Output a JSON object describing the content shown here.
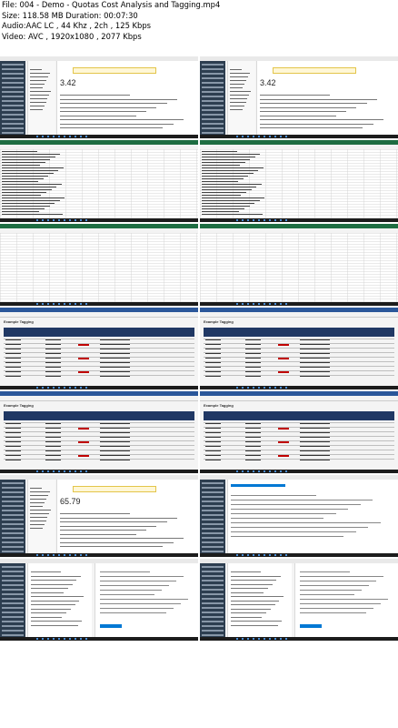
{
  "file_info": {
    "file": "File: 004 - Demo - Quotas Cost Analysis and Tagging.mp4",
    "size": "Size: 118.58 MB Duration: 00:07:30",
    "audio": "Audio:AAC LC , 44 Khz , 2ch , 125 Kbps",
    "video": "Video: AVC , 1920x1080 , 2077 Kbps"
  },
  "thumbnails": [
    {
      "name": "azure-cost-analysis",
      "kind": "portal",
      "big_value": "3.42"
    },
    {
      "name": "azure-cost-analysis-filter",
      "kind": "portal",
      "big_value": "3.42"
    },
    {
      "name": "excel-tag-list",
      "kind": "excel"
    },
    {
      "name": "excel-tag-list-2",
      "kind": "excel"
    },
    {
      "name": "excel-ribbon",
      "kind": "excel-blank"
    },
    {
      "name": "excel-ribbon-2",
      "kind": "excel-blank"
    },
    {
      "name": "example-tagging",
      "kind": "doc",
      "title": "Example Tagging"
    },
    {
      "name": "example-tagging-2",
      "kind": "doc",
      "title": "Example Tagging"
    },
    {
      "name": "example-tagging-3",
      "kind": "doc",
      "title": "Example Tagging"
    },
    {
      "name": "example-tagging-4",
      "kind": "doc",
      "title": "Example Tagging"
    },
    {
      "name": "azure-cost-analysis-2",
      "kind": "portal",
      "big_value": "65.79"
    },
    {
      "name": "azure-quota-list",
      "kind": "portal-list"
    },
    {
      "name": "azure-new-support-request",
      "kind": "portal-form"
    },
    {
      "name": "azure-new-support-request-2",
      "kind": "portal-form2"
    }
  ],
  "colors": {
    "portal_dark": "#2d3e50",
    "azure_blue": "#0078d4",
    "excel_green": "#1e6d42",
    "doc_header": "#203864",
    "taskbar": "#1c1c1c"
  }
}
